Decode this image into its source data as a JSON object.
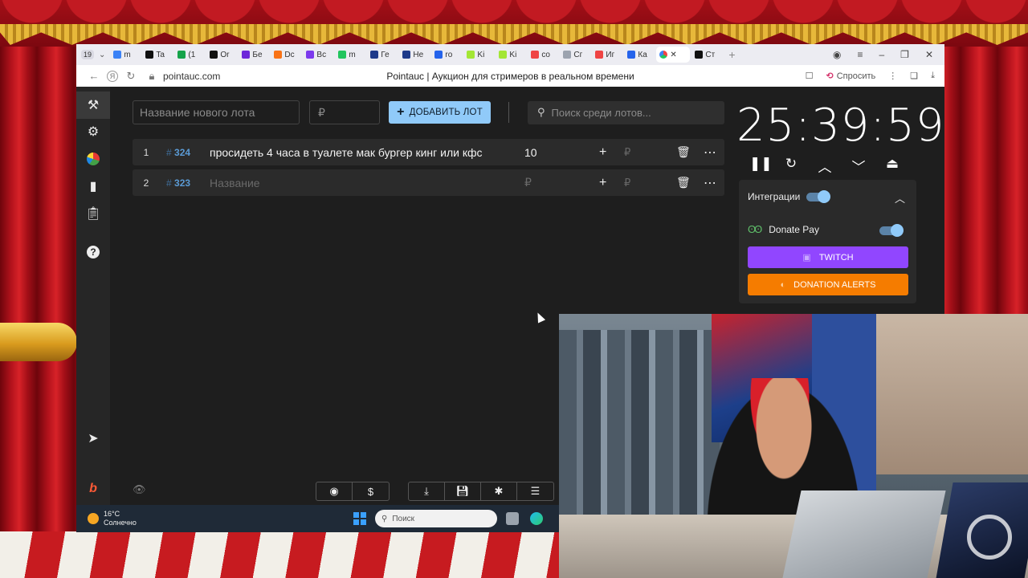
{
  "browser": {
    "tab_count": "19",
    "tabs": [
      {
        "label": "m",
        "color": "#3b82f6"
      },
      {
        "label": "Ta",
        "color": "#111111"
      },
      {
        "label": "(1",
        "color": "#16a34a"
      },
      {
        "label": "Or",
        "color": "#111111"
      },
      {
        "label": "Бе",
        "color": "#6d28d9"
      },
      {
        "label": "Dc",
        "color": "#f97316"
      },
      {
        "label": "Вс",
        "color": "#7c3aed"
      },
      {
        "label": "m",
        "color": "#22c55e"
      },
      {
        "label": "Ге",
        "color": "#1e3a8a"
      },
      {
        "label": "Не",
        "color": "#1e3a8a"
      },
      {
        "label": "ro",
        "color": "#2563eb"
      },
      {
        "label": "Ki",
        "color": "#a3e635"
      },
      {
        "label": "Ki",
        "color": "#a3e635"
      },
      {
        "label": "co",
        "color": "#ef4444"
      },
      {
        "label": "Сг",
        "color": "#9ca3af"
      },
      {
        "label": "Иг",
        "color": "#ef4444"
      },
      {
        "label": "Ка",
        "color": "#2563eb"
      }
    ],
    "url": "pointauc.com",
    "page_title": "Pointauc | Аукцион для стримеров в реальном времени",
    "ask_label": "Спросить"
  },
  "app": {
    "new_lot_placeholder": "Название нового лота",
    "price_placeholder": "₽",
    "add_button": "ДОБАВИТЬ ЛОТ",
    "search_placeholder": "Поиск среди лотов...",
    "lots": [
      {
        "index": "1",
        "id": "324",
        "name": "просидеть 4 часа в туалете мак бургер кинг или кфс",
        "amount": "10"
      },
      {
        "index": "2",
        "id": "323",
        "name": "Название",
        "amount": "₽"
      }
    ],
    "rub_symbol": "₽",
    "timer": "25:39:59",
    "integrations": {
      "title": "Интеграции",
      "donate_pay": "Donate Pay",
      "twitch": "TWITCH",
      "donation_alerts": "DONATION ALERTS"
    }
  },
  "taskbar": {
    "temperature": "16°C",
    "weather": "Солнечно",
    "search": "Поиск"
  }
}
